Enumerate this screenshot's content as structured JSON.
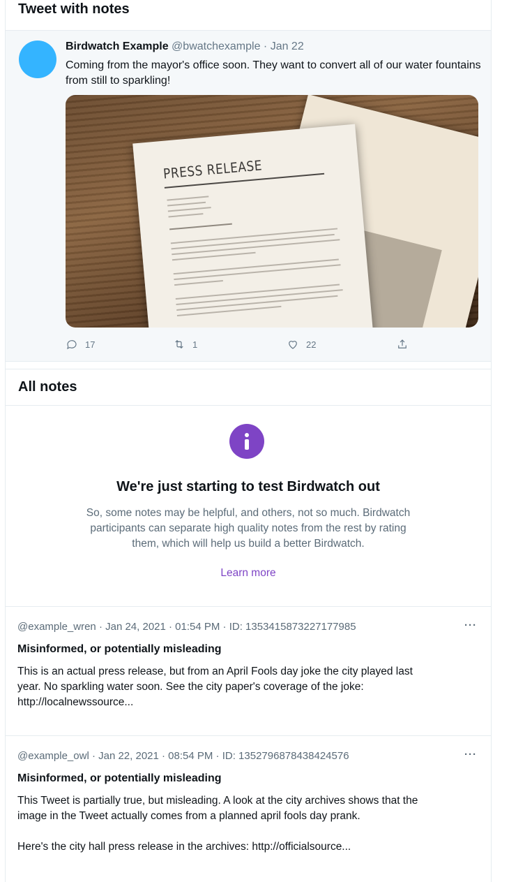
{
  "tweet_section": {
    "title": "Tweet with notes"
  },
  "tweet": {
    "author_name": "Birdwatch Example",
    "meta": " @bwatchexample · Jan 22",
    "text": "Coming from the mayor's office soon. They want to convert all of our water fountains from still to sparkling!",
    "image": {
      "heading": "PRESS RELEASE"
    },
    "actions": {
      "replies": "17",
      "retweets": "1",
      "likes": "22"
    },
    "icons": [
      "reply-icon",
      "retweet-icon",
      "like-icon",
      "share-icon"
    ],
    "avatar_color": "#34b4ff"
  },
  "notes_section": {
    "title": "All notes"
  },
  "notice": {
    "title": "We're just starting to test Birdwatch out",
    "body": "So, some notes may be helpful, and others, not so much. Birdwatch participants can separate high quality notes from the rest by rating them, which will help us build a better Birdwatch.",
    "link": "Learn more",
    "accent_color": "#7e44c5"
  },
  "notes": [
    {
      "meta": "@example_wren · Jan 24, 2021 · 01:54 PM · ID: 1353415873227177985",
      "more": "···",
      "classification": "Misinformed, or potentially misleading",
      "paragraphs": [
        "This is an actual press release, but from an April Fools day joke the city played last year. No sparkling water soon. See the city paper's coverage of the joke: http://localnewssource..."
      ]
    },
    {
      "meta": "@example_owl · Jan 22, 2021 · 08:54 PM · ID: 1352796878438424576",
      "more": "···",
      "classification": "Misinformed, or potentially misleading",
      "paragraphs": [
        "This Tweet is partially true, but misleading. A look at the city archives shows that the image in the Tweet actually comes from a planned april fools day prank.",
        "Here's the city hall press release in the archives: http://officialsource..."
      ]
    }
  ]
}
